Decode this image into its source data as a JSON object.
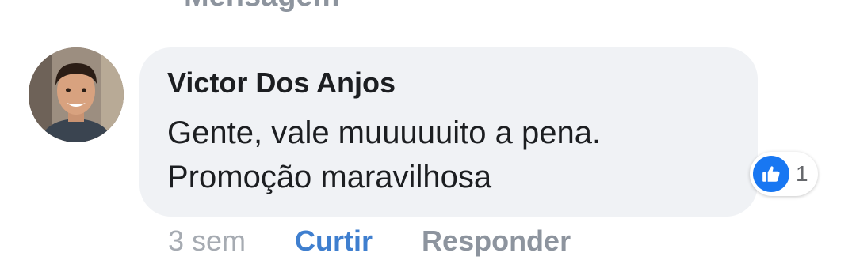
{
  "previous_comment": {
    "action_label": "Mensagem"
  },
  "comment": {
    "author": "Victor Dos Anjos",
    "text_lines": [
      "Gente, vale muuuuuito a pena.",
      "Promoção maravilhosa"
    ],
    "avatar_icon": "user-avatar-photo",
    "reaction": {
      "icon": "thumbs-up-icon",
      "count": "1",
      "color": "#1877f2"
    },
    "time": "3 sem",
    "like_label": "Curtir",
    "reply_label": "Responder"
  },
  "colors": {
    "bubble": "#f0f2f5",
    "like_action": "#3f7fcf",
    "muted": "#8d949e"
  }
}
